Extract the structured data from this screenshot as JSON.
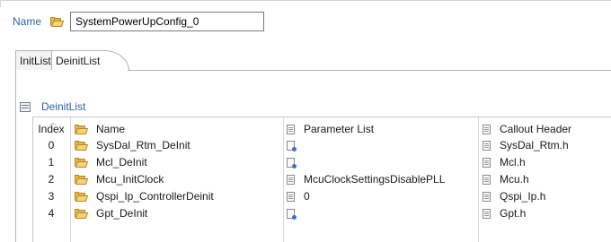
{
  "header": {
    "name_label": "Name",
    "name_value": "SystemPowerUpConfig_0"
  },
  "tabs": [
    {
      "label": "InitList",
      "selected": false
    },
    {
      "label": "DeinitList",
      "selected": true
    }
  ],
  "section": {
    "title": "DeinitList"
  },
  "table": {
    "columns": [
      "Index",
      "Name",
      "Parameter List",
      "Callout Header"
    ],
    "rows": [
      {
        "index": "0",
        "name": "SysDal_Rtm_DeInit",
        "param": "",
        "header": "SysDal_Rtm.h"
      },
      {
        "index": "1",
        "name": "Mcl_DeInit",
        "param": "",
        "header": "Mcl.h"
      },
      {
        "index": "2",
        "name": "Mcu_InitClock",
        "param": "McuClockSettingsDisablePLL",
        "header": "Mcu.h"
      },
      {
        "index": "3",
        "name": "Qspi_Ip_ControllerDeinit",
        "param": "0",
        "header": "Qspi_Ip.h"
      },
      {
        "index": "4",
        "name": "Gpt_DeInit",
        "param": "",
        "header": "Gpt.h"
      }
    ]
  },
  "icons": {
    "folder": "folder-icon",
    "document": "document-icon",
    "parameter": "parameter-document-icon",
    "section": "section-list-icon"
  }
}
